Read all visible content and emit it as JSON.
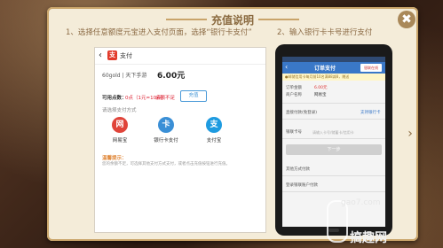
{
  "dialog": {
    "title": "充值说明",
    "close_label": "✖",
    "next_arrow": "›"
  },
  "steps": {
    "step1": "1、选择任意额度元宝进入支付页面，选择“银行卡支付”",
    "step2": "2、输入银行卡卡号进行支付"
  },
  "left_screen": {
    "header_back": "‹",
    "pay_logo": "支",
    "header_title": "支付",
    "product": "60gold | 天下手游",
    "price": "6.00元",
    "balance_label": "可用点数：",
    "balance_value": "0点（1元=10点）",
    "balance_note": "余额不足",
    "recharge_button": "充值",
    "choose_method": "请选择支付方式",
    "methods": [
      {
        "icon": "网",
        "label": "网易宝",
        "color": "#e0443a"
      },
      {
        "icon": "卡",
        "label": "银行卡支付",
        "color": "#3a8fd6"
      },
      {
        "icon": "支",
        "label": "支付宝",
        "color": "#1e9be0"
      }
    ],
    "tip_title": "温馨提示：",
    "tip_text": "您的余额不足，可选择其他支付方式支付，或者点击充值按钮进行充值。"
  },
  "right_screen": {
    "nav_back": "‹",
    "nav_title": "订单支付",
    "unionpay_label": "银联在线",
    "notice": "●邮储信用卡每月前10名满88减8，赠送",
    "order_amount_label": "订单金额",
    "order_amount_value": "6.00元",
    "merchant_label": "商户名称",
    "merchant_value": "网易宝",
    "direct_pay_label": "直接付款(免登录)",
    "other_cards_link": "支持银行卡",
    "card_number_label": "银联卡号",
    "card_number_placeholder": "请输入卡号/储蓄卡/信用卡",
    "next_button": "下一步",
    "other_methods_label": "其他方式付款",
    "login_pay_label": "登录银联账户付款"
  },
  "watermark": {
    "domain": "gao7.com",
    "brand": "搞趣网"
  }
}
